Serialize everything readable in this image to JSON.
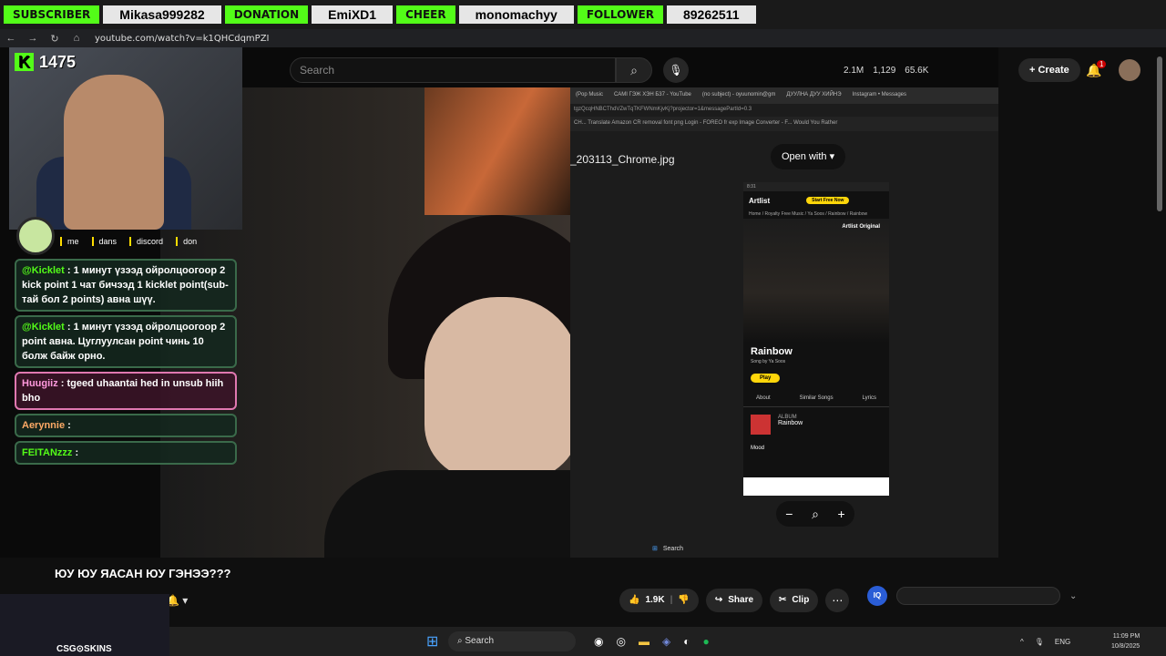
{
  "alerts": [
    {
      "tag": "SUBSCRIBER",
      "who": "Mikasa999282"
    },
    {
      "tag": "DONATION",
      "who": "EmiXD1"
    },
    {
      "tag": "CHEER",
      "who": "monomachyy"
    },
    {
      "tag": "FOLLOWER",
      "who": "89262511"
    }
  ],
  "browser": {
    "url": "youtube.com/watch?v=k1QHCdqmPZI"
  },
  "header": {
    "search_placeholder": "Search",
    "stat_views": "2.1M",
    "stat_watch": "1,129",
    "stat_likes": "65.6K",
    "create_label": "Create",
    "notif_count": "1"
  },
  "stream": {
    "kick_count": "1475",
    "links": [
      "me",
      "dans",
      "discord",
      "don"
    ]
  },
  "chat": [
    {
      "user": "@Kicklet",
      "text": " : 1 минут үзээд ойролцоогоор 2 kick point 1 чат бичээд 1 kicklet point(sub-тай бол 2 points) авна шүү."
    },
    {
      "user": "@Kicklet",
      "text": " : 1 минут үзээд ойролцоогоор 2 point авна. Цуглуулсан point чинь 10 болж байж орно."
    },
    {
      "user": "Huugiiz",
      "text": " : tgeed uhaantai hed in unsub hiih bho"
    },
    {
      "user": "Aerynnie",
      "text": " : "
    },
    {
      "user": "FEITANzzz",
      "text": " : "
    }
  ],
  "viewer": {
    "tabs": [
      "(Pop Music",
      "САМІ ГЭЖ ХЭН Б37 - YouTube",
      "(no subject) - oyuunomin@gm",
      "ДУУЛНА ДУУ ХИЙНЭ",
      "Instagram • Messages"
    ],
    "url": "tgzQcqHNBCThdVZwTqTKFWNmKjvKj?projector=1&messagePartId=0.3",
    "bookmarks": "CH...   Translate   Amazon   CR removal   font   png   Login - FOREO   fr   exp   Image Converter - F...   Would You Rather",
    "filename": "_203113_Chrome.jpg",
    "open_with": "Open with",
    "phone": {
      "time": "8:31",
      "brand": "Artlist",
      "free_btn": "Start Free Now",
      "crumbs": "Home / Royalty Free Music / Ya Soos / Rainbow / Rainbow",
      "original_label": "Artlist Original",
      "song": "Rainbow",
      "song_by": "Song by Ya Soos",
      "play": "Play",
      "tabs": [
        "About",
        "Similar Songs",
        "Lyrics"
      ],
      "album_label": "ALBUM",
      "album_name": "Rainbow",
      "mood": "Mood"
    },
    "taskbar_search": "Search"
  },
  "video": {
    "title": "ЮУ ЮУ ЯАСАН ЮУ ГЭНЭЭ???"
  },
  "actions": {
    "like_count": "1.9K",
    "share": "Share",
    "clip": "Clip",
    "more": "⋯"
  },
  "csgo": {
    "label": "CSG⊙SKINS"
  },
  "taskbar": {
    "search": "Search",
    "lang": "ENG",
    "time": "11:09 PM",
    "date": "10/8/2025"
  }
}
